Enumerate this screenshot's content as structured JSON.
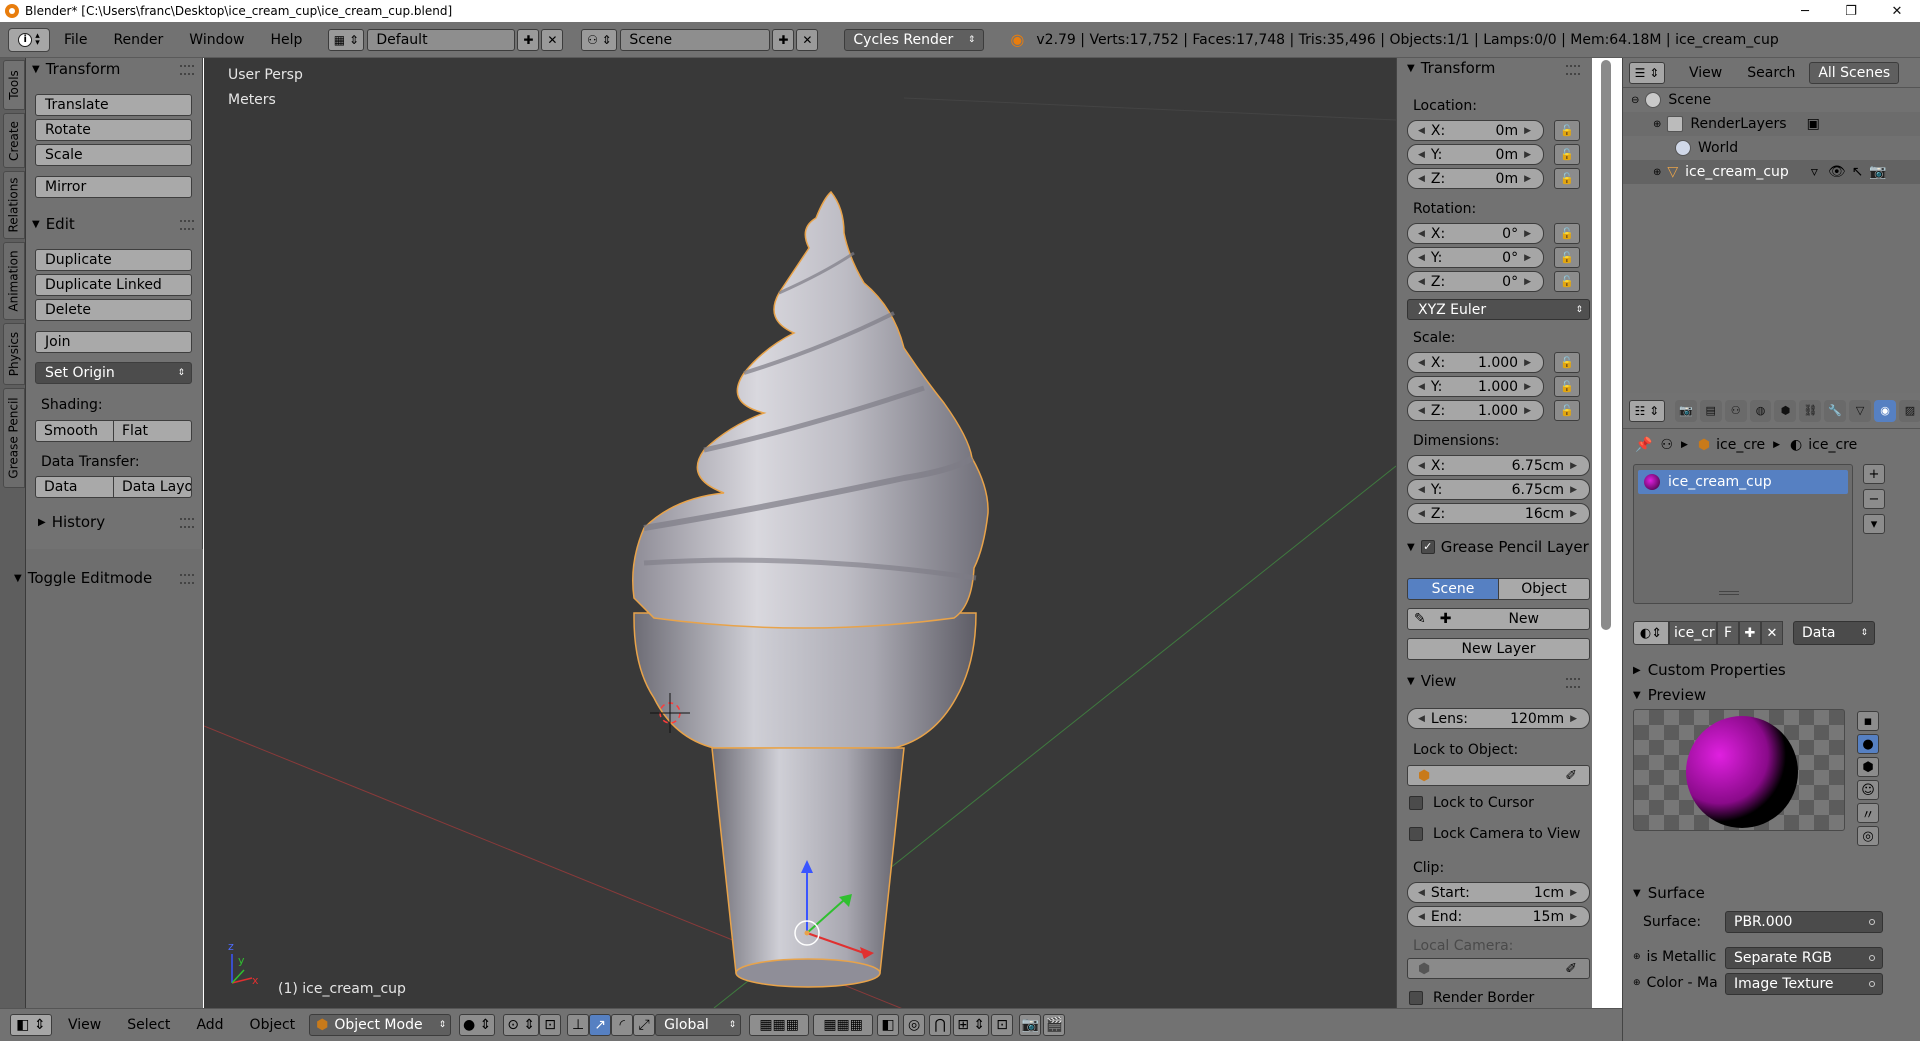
{
  "window": {
    "title": "Blender* [C:\\Users\\franc\\Desktop\\ice_cream_cup\\ice_cream_cup.blend]",
    "minimize": "─",
    "maximize": "❐",
    "close": "✕"
  },
  "infobar": {
    "menus": [
      "File",
      "Render",
      "Window",
      "Help"
    ],
    "layout": "Default",
    "scene": "Scene",
    "engine": "Cycles Render",
    "stats": "v2.79 | Verts:17,752 | Faces:17,748 | Tris:35,496 | Objects:1/1 | Lamps:0/0 | Mem:64.18M | ice_cream_cup"
  },
  "tool_tabs": [
    "Tools",
    "Create",
    "Relations",
    "Animation",
    "Physics",
    "Grease Pencil"
  ],
  "tool_shelf": {
    "transform_header": "Transform",
    "translate": "Translate",
    "rotate": "Rotate",
    "scale": "Scale",
    "mirror": "Mirror",
    "edit_header": "Edit",
    "duplicate": "Duplicate",
    "duplicate_linked": "Duplicate Linked",
    "delete": "Delete",
    "join": "Join",
    "set_origin": "Set Origin",
    "shading_label": "Shading:",
    "smooth": "Smooth",
    "flat": "Flat",
    "data_transfer_label": "Data Transfer:",
    "data": "Data",
    "data_layout": "Data Layo",
    "history_header": "History",
    "toggle_editmode": "Toggle Editmode"
  },
  "viewport": {
    "view_name": "User Persp",
    "units": "Meters",
    "object_label": "(1) ice_cream_cup",
    "axis_x": "x",
    "axis_y": "y",
    "axis_z": "z"
  },
  "npanel": {
    "transform_header": "Transform",
    "location_label": "Location:",
    "location": [
      {
        "k": "X:",
        "v": "0m"
      },
      {
        "k": "Y:",
        "v": "0m"
      },
      {
        "k": "Z:",
        "v": "0m"
      }
    ],
    "rotation_label": "Rotation:",
    "rotation": [
      {
        "k": "X:",
        "v": "0°"
      },
      {
        "k": "Y:",
        "v": "0°"
      },
      {
        "k": "Z:",
        "v": "0°"
      }
    ],
    "rotation_mode": "XYZ Euler",
    "scale_label": "Scale:",
    "scale": [
      {
        "k": "X:",
        "v": "1.000"
      },
      {
        "k": "Y:",
        "v": "1.000"
      },
      {
        "k": "Z:",
        "v": "1.000"
      }
    ],
    "dimensions_label": "Dimensions:",
    "dimensions": [
      {
        "k": "X:",
        "v": "6.75cm"
      },
      {
        "k": "Y:",
        "v": "6.75cm"
      },
      {
        "k": "Z:",
        "v": "16cm"
      }
    ],
    "grease_header": "Grease Pencil Layer",
    "scene_btn": "Scene",
    "object_btn": "Object",
    "new_btn": "New",
    "new_layer_btn": "New Layer",
    "view_header": "View",
    "lens_k": "Lens:",
    "lens_v": "120mm",
    "lock_object_label": "Lock to Object:",
    "lock_cursor": "Lock to Cursor",
    "lock_camera": "Lock Camera to View",
    "clip_label": "Clip:",
    "clip_start_k": "Start:",
    "clip_start_v": "1cm",
    "clip_end_k": "End:",
    "clip_end_v": "15m",
    "local_camera_label": "Local Camera:",
    "render_border": "Render Border"
  },
  "outliner": {
    "view": "View",
    "search": "Search",
    "filter": "All Scenes",
    "rows": [
      "Scene",
      "RenderLayers",
      "World",
      "ice_cream_cup"
    ]
  },
  "properties": {
    "crumb_object": "ice_cre",
    "crumb_material": "ice_cre",
    "material_slot": "ice_cream_cup",
    "mat_name": "ice_cr",
    "mat_fake": "F",
    "link_mode": "Data",
    "custom_props": "Custom Properties",
    "preview": "Preview",
    "surface_header": "Surface",
    "surface_label": "Surface:",
    "surface_value": "PBR.000",
    "metallic_label": "is Metallic",
    "metallic_value": "Separate RGB",
    "color_label": "Color - Ma",
    "color_value": "Image Texture"
  },
  "bottombar": {
    "view": "View",
    "select": "Select",
    "add": "Add",
    "object": "Object",
    "mode": "Object Mode",
    "orientation": "Global"
  },
  "colors": {
    "accent_blue": "#5680c2",
    "selection_orange": "#e8a34a",
    "viewport_bg": "#393939",
    "panel_bg": "#727272"
  }
}
